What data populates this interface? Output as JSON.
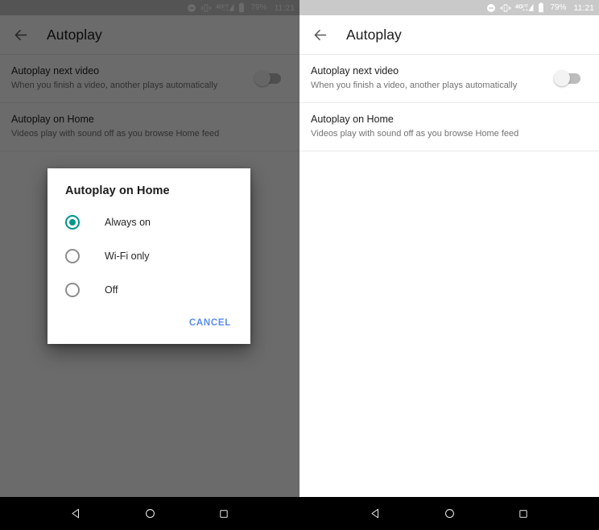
{
  "status_bar": {
    "icons": [
      "do-not-disturb-icon",
      "vibrate-icon",
      "4g-lte-signal-icon",
      "battery-icon"
    ],
    "network_label": "4G",
    "network_sub": "LTE",
    "battery_percent": "79%",
    "clock": "11:21",
    "background_color": "#c9c9c9",
    "foreground_color": "#ffffff"
  },
  "app_bar": {
    "back_icon": "arrow-left-icon",
    "title": "Autoplay"
  },
  "settings": {
    "items": [
      {
        "title": "Autoplay next video",
        "subtitle": "When you finish a video, another plays automatically",
        "control": "toggle",
        "toggle_state": "off"
      },
      {
        "title": "Autoplay on Home",
        "subtitle": "Videos play with sound off as you browse Home feed",
        "control": "none"
      }
    ]
  },
  "dialog": {
    "visible_on": "left-panel",
    "title": "Autoplay on Home",
    "options": [
      {
        "label": "Always on",
        "selected": true
      },
      {
        "label": "Wi-Fi only",
        "selected": false
      },
      {
        "label": "Off",
        "selected": false
      }
    ],
    "cancel_label": "CANCEL",
    "accent_color": "#009688",
    "cancel_color": "#5b8dee"
  },
  "nav_bar": {
    "buttons": [
      "back-triangle-icon",
      "home-circle-icon",
      "recents-square-icon"
    ],
    "background_color": "#000000"
  }
}
